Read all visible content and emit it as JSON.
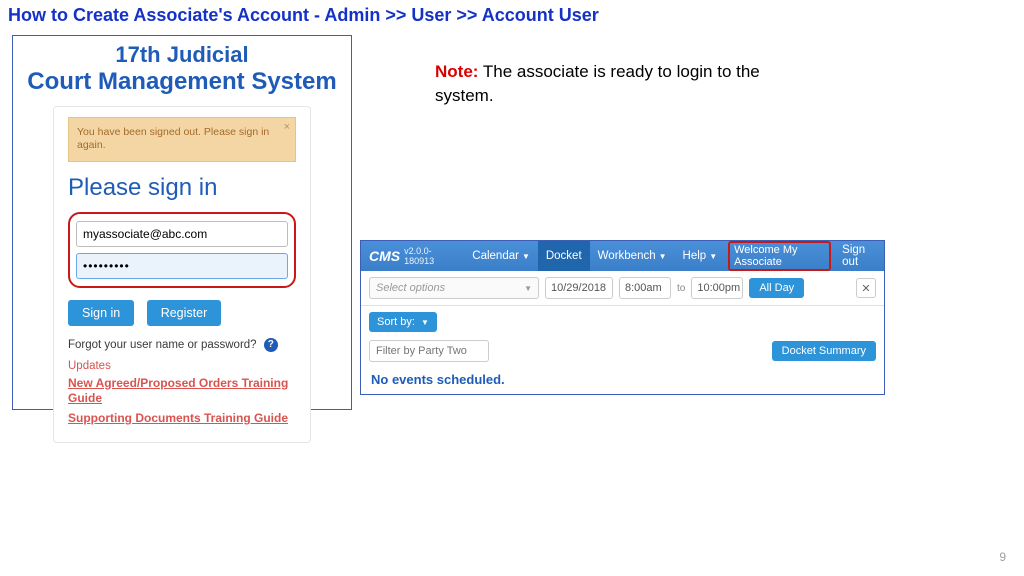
{
  "slide": {
    "title": "How to Create Associate's Account  - Admin >> User >> Account User",
    "page_number": "9"
  },
  "note": {
    "label": "Note:",
    "body": "The associate is ready to login to the system."
  },
  "login": {
    "brand_line1": "17th Judicial",
    "brand_line2": "Court Management System",
    "alert_text": "You have been signed out. Please sign in again.",
    "heading": "Please sign in",
    "email_value": "myassociate@abc.com",
    "password_value": "•••••••••",
    "signin_label": "Sign in",
    "register_label": "Register",
    "forgot_text": "Forgot your user name or password?",
    "help_symbol": "?",
    "updates_label": "Updates",
    "guide1": "New Agreed/Proposed Orders Training Guide",
    "guide2": "Supporting Documents Training Guide"
  },
  "cms": {
    "brand": "CMS",
    "version": "v2.0.0-180913",
    "nav": {
      "calendar": "Calendar",
      "docket": "Docket",
      "workbench": "Workbench",
      "help": "Help"
    },
    "welcome": "Welcome My Associate",
    "signout": "Sign out",
    "select_placeholder": "Select options",
    "date": "10/29/2018",
    "time_from": "8:00am",
    "to_label": "to",
    "time_to": "10:00pm",
    "allday": "All Day",
    "close_symbol": "✕",
    "sort_label": "Sort by:",
    "filter_placeholder": "Filter by Party Two",
    "summary_label": "Docket Summary",
    "no_events": "No events scheduled."
  }
}
